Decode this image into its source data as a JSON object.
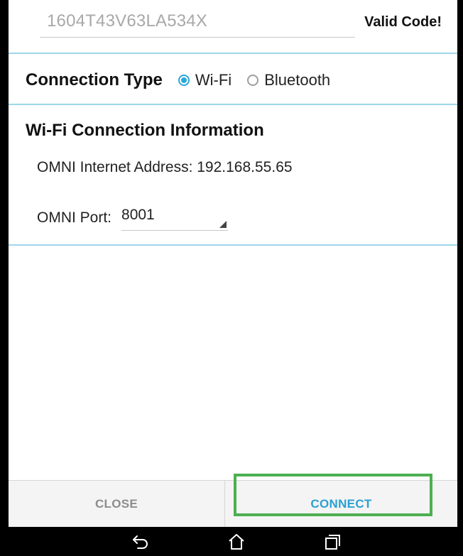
{
  "code_field": {
    "value": "1604T43V63LA534X"
  },
  "validation": {
    "text": "Valid Code!"
  },
  "connection_type": {
    "label": "Connection Type",
    "options": [
      {
        "label": "Wi-Fi",
        "selected": true
      },
      {
        "label": "Bluetooth",
        "selected": false
      }
    ]
  },
  "wifi_section": {
    "title": "Wi-Fi Connection Information",
    "address_text": "OMNI Internet Address: 192.168.55.65",
    "port_label": "OMNI Port:",
    "port_value": "8001"
  },
  "buttons": {
    "close": "CLOSE",
    "connect": "CONNECT"
  },
  "colors": {
    "accent": "#2aa8d8",
    "divider": "#9fd6e8",
    "highlight": "#4caf50"
  },
  "icons": {
    "back": "back-arrow-icon",
    "home": "home-icon",
    "recent": "recent-apps-icon"
  }
}
